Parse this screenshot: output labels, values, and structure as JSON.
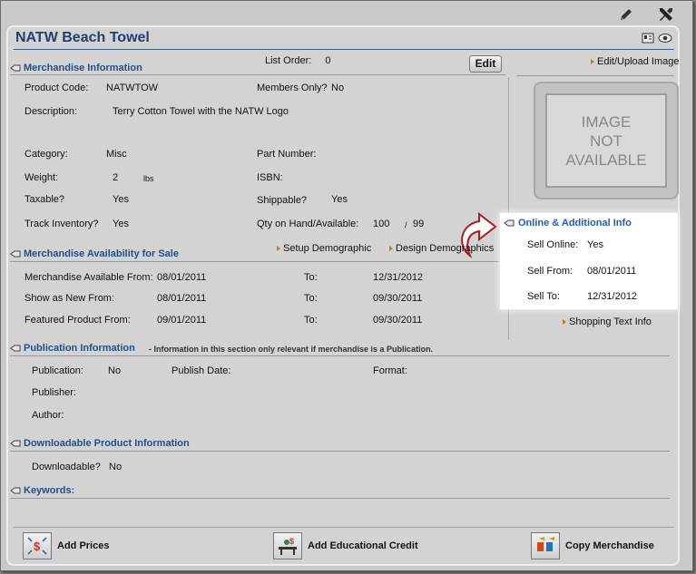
{
  "top_tools": {
    "edit_icon": "pencil-icon",
    "tools_icon": "wrench-screwdriver-icon"
  },
  "title": "NATW Beach Towel",
  "list_order": {
    "label": "List Order:",
    "value": "0"
  },
  "edit_button": "Edit",
  "edit_upload_image": "Edit/Upload Image",
  "image_placeholder": {
    "line1": "IMAGE",
    "line2": "NOT",
    "line3": "AVAILABLE"
  },
  "merch_info": {
    "heading": "Merchandise Information",
    "product_code": {
      "label": "Product Code:",
      "value": "NATWTOW"
    },
    "members_only": {
      "label": "Members Only?",
      "value": "No"
    },
    "description": {
      "label": "Description:",
      "value": "Terry Cotton Towel with the NATW Logo"
    },
    "category": {
      "label": "Category:",
      "value": "Misc"
    },
    "part_number": {
      "label": "Part Number:",
      "value": ""
    },
    "weight": {
      "label": "Weight:",
      "value": "2",
      "unit": "lbs"
    },
    "isbn": {
      "label": "ISBN:",
      "value": ""
    },
    "taxable": {
      "label": "Taxable?",
      "value": "Yes"
    },
    "shippable": {
      "label": "Shippable?",
      "value": "Yes"
    },
    "track_inventory": {
      "label": "Track Inventory?",
      "value": "Yes"
    },
    "qty": {
      "label": "Qty on Hand/Available:",
      "on_hand": "100",
      "sep": "/",
      "available": "99"
    }
  },
  "availability": {
    "heading": "Merchandise Availability for Sale",
    "setup_demographic": "Setup Demographic",
    "design_demographics": "Design Demographics",
    "rows": [
      {
        "label": "Merchandise Available From:",
        "from": "08/01/2011",
        "to_label": "To:",
        "to": "12/31/2012"
      },
      {
        "label": "Show as New From:",
        "from": "08/01/2011",
        "to_label": "To:",
        "to": "09/30/2011"
      },
      {
        "label": "Featured Product From:",
        "from": "09/01/2011",
        "to_label": "To:",
        "to": "09/30/2011"
      }
    ]
  },
  "online_info": {
    "heading": "Online & Additional Info",
    "sell_online": {
      "label": "Sell Online:",
      "value": "Yes"
    },
    "sell_from": {
      "label": "Sell From:",
      "value": "08/01/2011"
    },
    "sell_to": {
      "label": "Sell To:",
      "value": "12/31/2012"
    }
  },
  "shopping_text_info": "Shopping Text Info",
  "publication": {
    "heading": "Publication Information",
    "note": "- Information in this section only relevant if merchandise is a Publication.",
    "publication": {
      "label": "Publication:",
      "value": "No"
    },
    "publish_date": {
      "label": "Publish Date:",
      "value": ""
    },
    "format": {
      "label": "Format:",
      "value": ""
    },
    "publisher": {
      "label": "Publisher:",
      "value": ""
    },
    "author": {
      "label": "Author:",
      "value": ""
    }
  },
  "downloadable": {
    "heading": "Downloadable Product Information",
    "downloadable": {
      "label": "Downloadable?",
      "value": "No"
    }
  },
  "keywords": {
    "heading": "Keywords:"
  },
  "bottom_buttons": {
    "add_prices": "Add Prices",
    "add_educational_credit": "Add Educational Credit",
    "copy_merchandise": "Copy Merchandise"
  }
}
